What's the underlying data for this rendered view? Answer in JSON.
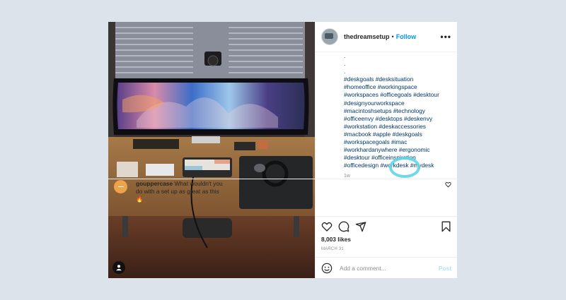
{
  "post": {
    "author": {
      "username": "thedreamsetup",
      "separator": "•",
      "follow_label": "Follow",
      "more_label": "•••"
    },
    "caption_dots": [
      ".",
      ".",
      "."
    ],
    "caption_lines": [
      "#deskgoals #desksituation",
      "#homeoffice #workingspace",
      "#workspaces #officegoals #desktour",
      "#designyourworkspace",
      "#macintoshsetups #technology",
      "#officeenvy #desktops #deskenvy",
      "#workstation #deskaccessories",
      "#macbook #apple #deskgoals",
      "#workspacegoals #imac",
      "#workhardanywhere #ergonomic",
      "#desktour #officeinspiration",
      "#officedesign #workdesk #mydesk"
    ],
    "time_ago": "1w",
    "comment": {
      "username": "gouppercase",
      "text": "What wouldn't you do with a set up as great as this",
      "emoji": "🔥"
    },
    "likes": "8,003 likes",
    "date": "MARCH 31",
    "add_comment": {
      "placeholder": "Add a comment...",
      "post_label": "Post"
    },
    "icons": {
      "like": "heart-icon",
      "comment": "comment-icon",
      "share": "share-icon",
      "save": "bookmark-icon",
      "emoji": "smiley-icon",
      "user_tag": "person-icon",
      "more": "ellipsis-icon"
    },
    "colors": {
      "follow": "#0095f6",
      "hashtag": "#00376b",
      "highlight": "#5fd4e8",
      "post_disabled": "#b2dffc"
    }
  }
}
